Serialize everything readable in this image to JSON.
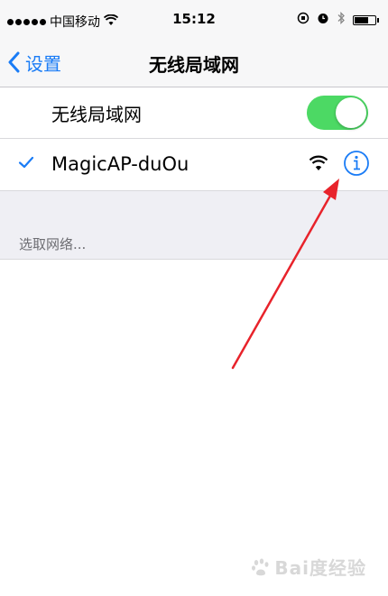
{
  "status_bar": {
    "carrier": "中国移动",
    "time": "15:12",
    "battery_level": 0.7
  },
  "nav": {
    "back_label": "设置",
    "title": "无线局域网"
  },
  "wifi_toggle": {
    "label": "无线局域网",
    "on": true
  },
  "connected_network": {
    "name": "MagicAP-duOu"
  },
  "choose_network": {
    "label": "选取网络..."
  },
  "watermark": {
    "text": "Bai度经验"
  },
  "colors": {
    "accent": "#1a7cf6",
    "toggle_on": "#4cd964",
    "arrow": "#e8232b",
    "group_bg": "#efeff4"
  }
}
